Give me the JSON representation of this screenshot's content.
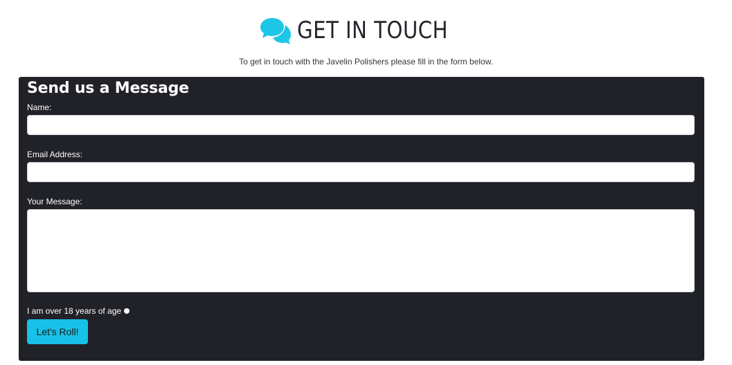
{
  "header": {
    "title": "GET IN TOUCH",
    "icon": "chat-bubbles-icon",
    "icon_color": "#1ec6e6",
    "subtitle": "To get in touch with the Javelin Polishers please fill in the form below."
  },
  "form": {
    "heading": "Send us a Message",
    "panel_color": "#212228",
    "name": {
      "label": "Name:",
      "value": ""
    },
    "email": {
      "label": "Email Address:",
      "value": ""
    },
    "message": {
      "label": "Your Message:",
      "value": ""
    },
    "age_check": {
      "label": "I am over 18 years of age",
      "checked": false
    },
    "submit_label": "Let's Roll!",
    "accent_color": "#17c1e8"
  }
}
